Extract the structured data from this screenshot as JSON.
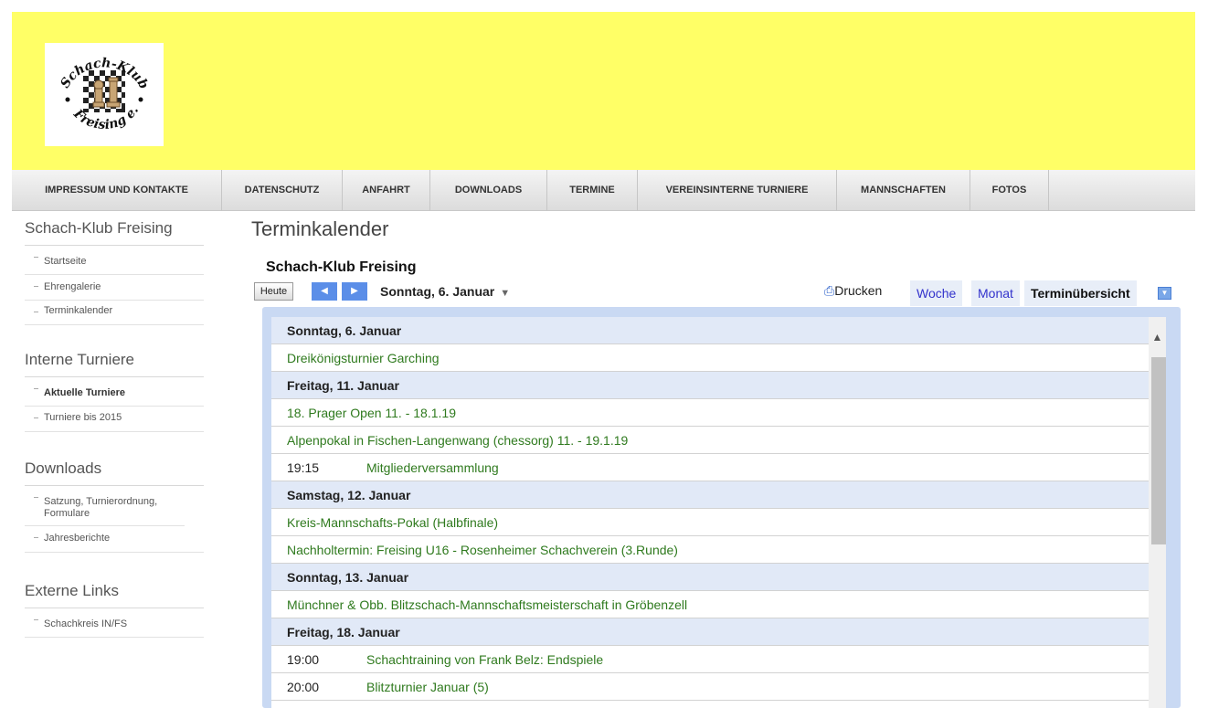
{
  "logo": {
    "text_top": "Schach-Klub",
    "text_bottom": "Freising e.V."
  },
  "nav": [
    {
      "label": "IMPRESSUM UND KONTAKTE"
    },
    {
      "label": "DATENSCHUTZ"
    },
    {
      "label": "ANFAHRT"
    },
    {
      "label": "DOWNLOADS"
    },
    {
      "label": "TERMINE"
    },
    {
      "label": "VEREINSINTERNE TURNIERE"
    },
    {
      "label": "MANNSCHAFTEN"
    },
    {
      "label": "FOTOS"
    }
  ],
  "sidebar": {
    "sections": [
      {
        "title": "Schach-Klub Freising",
        "items": [
          "Startseite",
          "Ehrengalerie",
          "Terminkalender"
        ]
      },
      {
        "title": "Interne Turniere",
        "items": [
          "Aktuelle Turniere",
          "Turniere bis 2015"
        ]
      },
      {
        "title": "Downloads",
        "items": [
          "Satzung, Turnierordnung, Formulare",
          "Jahresberichte"
        ]
      },
      {
        "title": "Externe Links",
        "items": [
          "Schachkreis IN/FS"
        ]
      }
    ]
  },
  "main": {
    "page_title": "Terminkalender",
    "calendar_title": "Schach-Klub Freising"
  },
  "toolbar": {
    "today": "Heute",
    "prev": "◀",
    "next": "▶",
    "date": "Sonntag, 6. Januar",
    "caret": "▼",
    "print": "Drucken",
    "tab_week": "Woche",
    "tab_month": "Monat",
    "tab_agenda": "Terminübersicht",
    "tab_drop": "▼"
  },
  "agenda": {
    "rows": [
      {
        "type": "day",
        "text": "Sonntag, 6. Januar"
      },
      {
        "type": "event",
        "time": "",
        "text": "Dreikönigsturnier Garching"
      },
      {
        "type": "day",
        "text": "Freitag, 11. Januar"
      },
      {
        "type": "event",
        "time": "",
        "text": "18. Prager Open 11. - 18.1.19"
      },
      {
        "type": "event",
        "time": "",
        "text": "Alpenpokal in Fischen-Langenwang (chessorg) 11. - 19.1.19"
      },
      {
        "type": "event",
        "time": "19:15",
        "text": "Mitgliederversammlung"
      },
      {
        "type": "day",
        "text": "Samstag, 12. Januar"
      },
      {
        "type": "event",
        "time": "",
        "text": "Kreis-Mannschafts-Pokal (Halbfinale)"
      },
      {
        "type": "event",
        "time": "",
        "text": "Nachholtermin: Freising U16 - Rosenheimer Schachverein (3.Runde)"
      },
      {
        "type": "day",
        "text": "Sonntag, 13. Januar"
      },
      {
        "type": "event",
        "time": "",
        "text": "Münchner & Obb. Blitzschach-Mannschaftsmeisterschaft in Gröbenzell"
      },
      {
        "type": "day",
        "text": "Freitag, 18. Januar"
      },
      {
        "type": "event",
        "time": "19:00",
        "text": "Schachtraining von Frank Belz: Endspiele"
      },
      {
        "type": "event",
        "time": "20:00",
        "text": "Blitzturnier Januar (5)"
      }
    ]
  },
  "colors": {
    "header_bg": "#ffff66",
    "event_text": "#2f7a1e",
    "day_bg": "#e1e9f7",
    "agenda_frame": "#c9d9f3"
  },
  "icons": {
    "print": "printer-icon",
    "scroll": "chevron-up-icon"
  }
}
